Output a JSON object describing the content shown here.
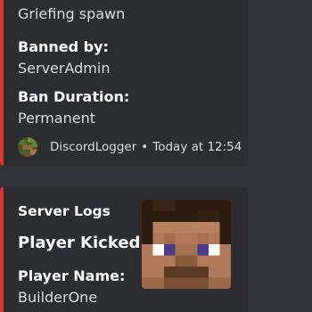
{
  "embeds": [
    {
      "color": "#e0382d",
      "fields": [
        {
          "value": "Griefing spawn"
        },
        {
          "name": "Banned by:",
          "value": "ServerAdmin"
        },
        {
          "name": "Ban Duration:",
          "value": "Permanent"
        }
      ],
      "footer": {
        "icon": "discord-logger-avatar-icon",
        "author": "DiscordLogger",
        "separator": "•",
        "timestamp": "Today at 12:54"
      }
    },
    {
      "color": "#e0382d",
      "author": "Server Logs",
      "title": "Player Kicked",
      "thumbnail": "minecraft-player-head-icon",
      "fields": [
        {
          "name": "Player Name:",
          "value": "BuilderOne"
        }
      ]
    }
  ]
}
